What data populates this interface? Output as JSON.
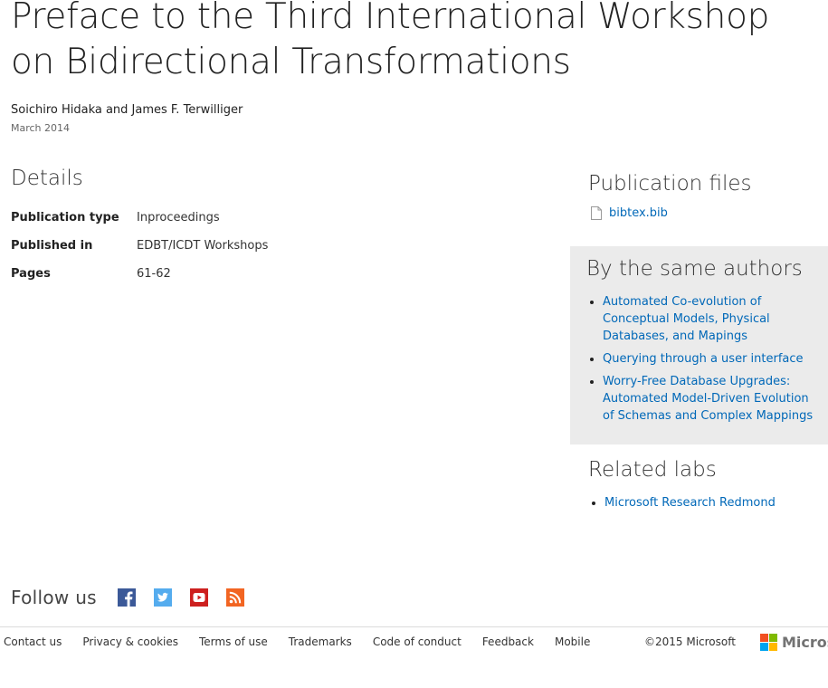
{
  "paper": {
    "title": "Preface to the Third International Workshop on Bidirectional Transformations",
    "authors": "Soichiro Hidaka and James F. Terwilliger",
    "date": "March 2014"
  },
  "details": {
    "heading": "Details",
    "rows": [
      {
        "key": "Publication type",
        "value": "Inproceedings"
      },
      {
        "key": "Published in",
        "value": "EDBT/ICDT Workshops"
      },
      {
        "key": "Pages",
        "value": "61-62"
      }
    ]
  },
  "publication_files": {
    "heading": "Publication files",
    "files": [
      {
        "name": "bibtex.bib",
        "icon": "file-icon"
      }
    ]
  },
  "same_authors": {
    "heading": "By the same authors",
    "items": [
      "Automated Co-evolution of Conceptual Models, Physical Databases, and Mapings",
      "Querying through a user interface",
      "Worry-Free Database Upgrades: Automated Model-Driven Evolution of Schemas and Complex Mappings"
    ]
  },
  "related_labs": {
    "heading": "Related labs",
    "items": [
      "Microsoft Research Redmond"
    ]
  },
  "follow": {
    "label": "Follow us",
    "icons": [
      "facebook-icon",
      "twitter-icon",
      "youtube-icon",
      "rss-icon"
    ]
  },
  "footer": {
    "links": [
      "Contact us",
      "Privacy & cookies",
      "Terms of use",
      "Trademarks",
      "Code of conduct",
      "Feedback",
      "Mobile"
    ],
    "copyright": "©2015 Microsoft",
    "logo_text": "Microsoft"
  },
  "colors": {
    "link": "#0068b8",
    "sidebar_panel": "#ebebeb",
    "facebook": "#3b5998",
    "twitter": "#55acee",
    "youtube": "#cd201f",
    "rss": "#f26522",
    "ms_red": "#f25022",
    "ms_green": "#7fba00",
    "ms_blue": "#00a4ef",
    "ms_yellow": "#ffb900"
  }
}
